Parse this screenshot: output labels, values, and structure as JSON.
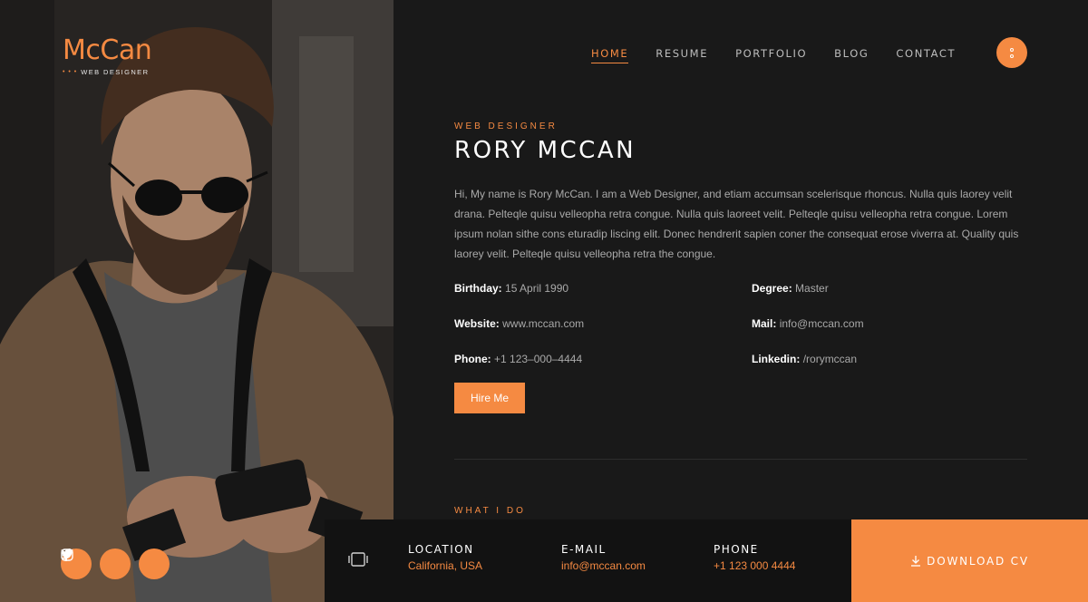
{
  "brand": {
    "name": "McCan",
    "tagline": "WEB DESIGNER",
    "dots": "• • •"
  },
  "nav": {
    "items": [
      {
        "label": "HOME",
        "active": true
      },
      {
        "label": "RESUME",
        "active": false
      },
      {
        "label": "PORTFOLIO",
        "active": false
      },
      {
        "label": "BLOG",
        "active": false
      },
      {
        "label": "CONTACT",
        "active": false
      }
    ]
  },
  "profile": {
    "subtitle": "WEB DESIGNER",
    "name": "RORY MCCAN",
    "bio": "Hi, My name is Rory McCan. I am a Web Designer, and etiam accumsan scelerisque rhoncus. Nulla quis laorey velit drana. Pelteqle quisu velleopha retra congue. Nulla quis laoreet velit. Pelteqle quisu velleopha retra congue. Lorem ipsum nolan sithe cons eturadip liscing elit. Donec hendrerit sapien coner the consequat erose viverra at. Quality quis laorey velit. Pelteqle quisu velleopha retra the congue.",
    "details": [
      {
        "label": "Birthday:",
        "value": "15 April 1990"
      },
      {
        "label": "Degree:",
        "value": "Master"
      },
      {
        "label": "Website:",
        "value": "www.mccan.com"
      },
      {
        "label": "Mail:",
        "value": "info@mccan.com"
      },
      {
        "label": "Phone:",
        "value": "+1 123–000–4444"
      },
      {
        "label": "Linkedin:",
        "value": "/rorymccan"
      }
    ],
    "hire_label": "Hire Me"
  },
  "section": {
    "what_i_do": "WHAT I DO"
  },
  "contact_bar": {
    "location": {
      "label": "LOCATION",
      "value": "California, USA"
    },
    "email": {
      "label": "E-MAIL",
      "value": "info@mccan.com"
    },
    "phone": {
      "label": "PHONE",
      "value": "+1 123 000 4444"
    },
    "download_label": "DOWNLOAD CV"
  },
  "social": [
    "facebook-icon",
    "twitter-icon",
    "instagram-icon"
  ],
  "colors": {
    "accent": "#f58a42",
    "background": "#191919",
    "bar": "#121212"
  }
}
